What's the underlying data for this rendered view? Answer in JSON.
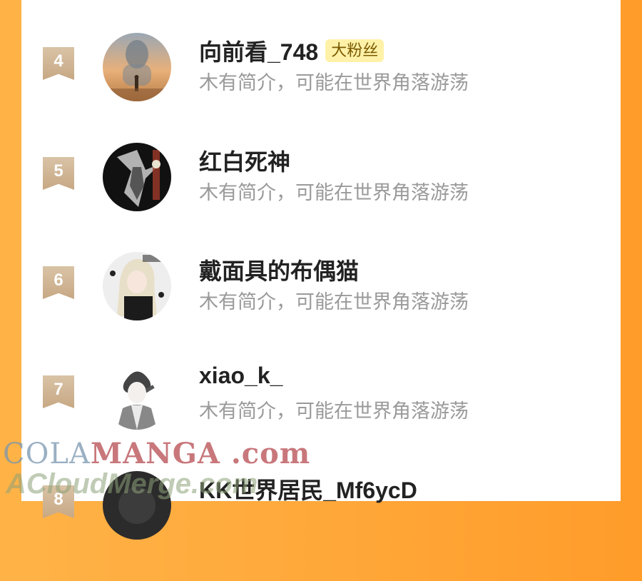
{
  "colors": {
    "background": "#ffa83a",
    "panel": "#ffffff",
    "rank_badge": "#c9ab88",
    "fan_badge_bg": "#fff2a8",
    "fan_badge_text": "#7a5a00",
    "name_text": "#222222",
    "bio_text": "#9a9a9a"
  },
  "list": [
    {
      "rank": "4",
      "name": "向前看_748",
      "badge": "大粉丝",
      "bio": "木有简介，可能在世界角落游荡",
      "avatar": "sunset-silhouette-avatar"
    },
    {
      "rank": "5",
      "name": "红白死神",
      "badge": "",
      "bio": "木有简介，可能在世界角落游荡",
      "avatar": "dark-armor-avatar"
    },
    {
      "rank": "6",
      "name": "戴面具的布偶猫",
      "badge": "",
      "bio": "木有简介，可能在世界角落游荡",
      "avatar": "blonde-girl-avatar"
    },
    {
      "rank": "7",
      "name": "xiao_k_",
      "badge": "",
      "bio": "木有简介，可能在世界角落游荡",
      "avatar": "sketch-boy-avatar"
    },
    {
      "rank": "8",
      "name": "KK世界居民_Mf6ycD",
      "badge": "",
      "bio": "",
      "avatar": "dark-round-avatar"
    }
  ],
  "watermark": {
    "line1_a": "COLA",
    "line1_b": "MANGA",
    "line1_c": " .com",
    "line2": "ACloudMerge.com"
  }
}
